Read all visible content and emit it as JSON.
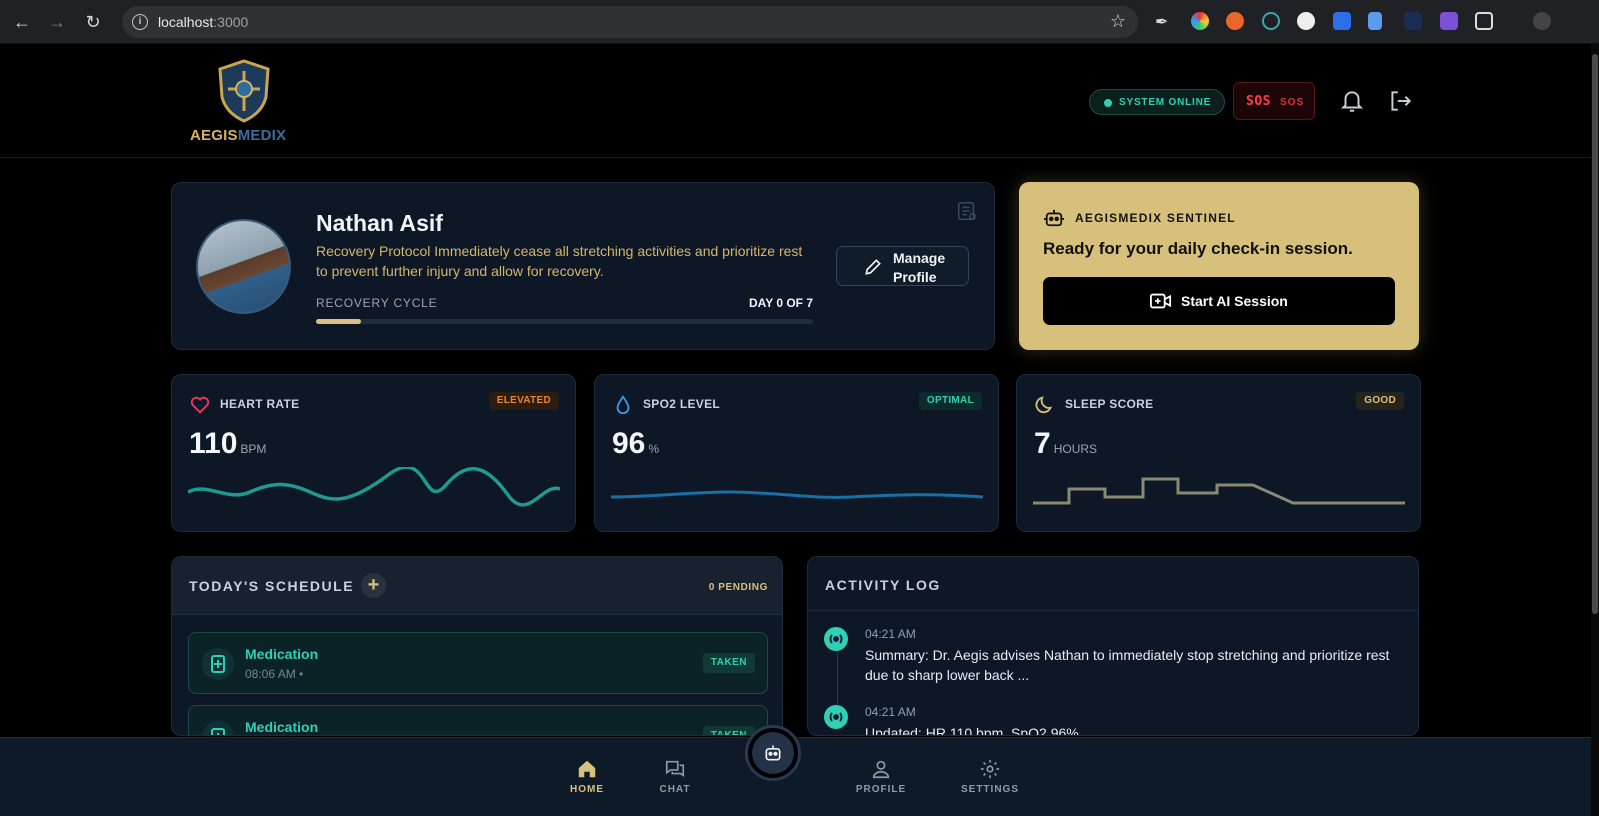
{
  "browser": {
    "url_host": "localhost",
    "url_port": ":3000"
  },
  "app": {
    "logo_text_a": "AEGIS",
    "logo_text_b": "MEDIX",
    "status": "SYSTEM ONLINE",
    "sos_glyph": "SOS",
    "sos_label": "SOS"
  },
  "profile": {
    "name": "Nathan Asif",
    "description": "Recovery Protocol Immediately cease all stretching activities and prioritize rest to prevent further injury and allow for recovery.",
    "cycle_label": "RECOVERY CYCLE",
    "cycle_day": "DAY 0 OF 7",
    "cycle_progress": 0.09,
    "manage_label": "Manage Profile"
  },
  "sentinel": {
    "title": "AEGISMEDIX SENTINEL",
    "message": "Ready for your daily check-in session.",
    "button": "Start AI Session"
  },
  "vitals": {
    "heart": {
      "label": "HEART RATE",
      "badge": "ELEVATED",
      "value": "110",
      "unit": "BPM",
      "color": "#1f9a92",
      "badge_color": "#e8852e"
    },
    "spo2": {
      "label": "SPO2 LEVEL",
      "badge": "OPTIMAL",
      "value": "96",
      "unit": "%",
      "color": "#1a6fa8",
      "badge_color": "#2fd0b5"
    },
    "sleep": {
      "label": "SLEEP SCORE",
      "badge": "GOOD",
      "value": "7",
      "unit": "HOURS",
      "color": "#8a8a72",
      "badge_color": "#d7c07c"
    }
  },
  "schedule": {
    "title": "TODAY'S SCHEDULE",
    "add": "+",
    "pending": "0 PENDING",
    "items": [
      {
        "name": "Medication",
        "time": "08:06 AM •",
        "status": "TAKEN"
      },
      {
        "name": "Medication",
        "time": "",
        "status": "TAKEN"
      }
    ]
  },
  "activity": {
    "title": "ACTIVITY LOG",
    "items": [
      {
        "time": "04:21 AM",
        "text": "Summary: Dr. Aegis advises Nathan to immediately stop stretching and prioritize rest due to sharp lower back ..."
      },
      {
        "time": "04:21 AM",
        "text": "Updated: HR 110 bpm, SpO2 96%"
      }
    ]
  },
  "nav": {
    "home": "HOME",
    "chat": "CHAT",
    "profile": "PROFILE",
    "settings": "SETTINGS"
  },
  "colors": {
    "accent_gold": "#d7c07c",
    "accent_teal": "#2fd0b5",
    "danger": "#ff3b4d",
    "card_bg": "#0d1726"
  }
}
